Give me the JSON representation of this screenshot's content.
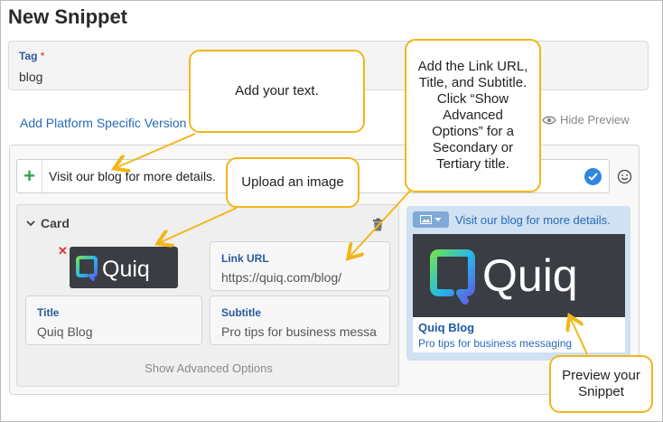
{
  "page": {
    "title": "New Snippet"
  },
  "tag": {
    "label": "Tag",
    "required": "*",
    "value": "blog"
  },
  "links": {
    "add_platform": "Add Platform Specific Version",
    "hide_preview": "Hide Preview"
  },
  "message": {
    "text": "Visit our blog for more details."
  },
  "card": {
    "heading": "Card",
    "remove": "✕",
    "logo_text": "Quiq",
    "link_url_label": "Link URL",
    "link_url_value": "https://quiq.com/blog/",
    "title_label": "Title",
    "title_value": "Quiq Blog",
    "subtitle_label": "Subtitle",
    "subtitle_value": "Pro tips for business messa",
    "show_advanced": "Show Advanced Options"
  },
  "preview": {
    "message": "Visit our blog for more details.",
    "logo_text": "Quiq",
    "card_title": "Quiq Blog",
    "card_subtitle": "Pro tips for business messaging"
  },
  "callouts": {
    "text": "Add your text.",
    "image": "Upload an image",
    "link": "Add the Link URL, Title, and Subtitle. Click “Show Advanced Options” for a Secondary or Tertiary title.",
    "preview": "Preview your Snippet"
  },
  "colors": {
    "accent": "#f2b61a",
    "link": "#2a6ab8",
    "label": "#2b5a9e",
    "preview_bg": "#cfe1f3",
    "logo_bg": "#3a3d44"
  },
  "icons": [
    "plus-icon",
    "check-icon",
    "smiley-icon",
    "chevron-down-icon",
    "trash-icon",
    "eye-icon",
    "image-icon"
  ]
}
